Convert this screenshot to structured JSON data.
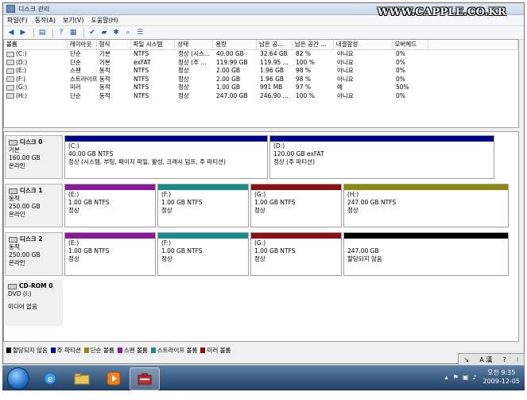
{
  "window": {
    "title": "디스크 관리"
  },
  "watermark": "WWW.CAPPLE.CO.KR",
  "menu": [
    "파일(F)",
    "동작(A)",
    "보기(V)",
    "도움말(H)"
  ],
  "volume_table": {
    "columns": [
      "볼륨",
      "레이아웃",
      "형식",
      "파일 시스템",
      "상태",
      "용량",
      "남은 공...",
      "남은 공간 ...",
      "내결함성",
      "오버헤드"
    ],
    "rows": [
      [
        "(C:)",
        "단순",
        "기본",
        "NTFS",
        "정상 (시스...",
        "40.00 GB",
        "32.64 GB",
        "82 %",
        "아니요",
        "0%"
      ],
      [
        "(D:)",
        "단순",
        "기본",
        "exFAT",
        "정상 (주 ...",
        "119.99 GB",
        "119.95 ...",
        "100 %",
        "아니요",
        "0%"
      ],
      [
        "(E:)",
        "스팬",
        "동적",
        "NTFS",
        "정상",
        "2.00 GB",
        "1.96 GB",
        "98 %",
        "아니요",
        "0%"
      ],
      [
        "(F:)",
        "스트라이프",
        "동적",
        "NTFS",
        "정상",
        "2.00 GB",
        "1.96 GB",
        "98 %",
        "아니요",
        "0%"
      ],
      [
        "(G:)",
        "미러",
        "동적",
        "NTFS",
        "정상",
        "1.00 GB",
        "991 MB",
        "97 %",
        "예",
        "50%"
      ],
      [
        "(H:)",
        "단순",
        "동적",
        "NTFS",
        "정상",
        "247.00 GB",
        "246.90 ...",
        "100 %",
        "아니요",
        "0%"
      ]
    ]
  },
  "disks": [
    {
      "name": "디스크 0",
      "line2": "기본",
      "line3": "160.00 GB",
      "line4": "온라인",
      "parts": [
        {
          "label": "(C:)",
          "line1": "40.00 GB NTFS",
          "line2": "정상 (시스템, 부팅, 페이지 파일, 활성, 크래시 덤프, 주 파티션)",
          "color": "#00008b"
        },
        {
          "label": "(D:)",
          "line1": "120.00 GB exFAT",
          "line2": "정상 (주 파티션)",
          "color": "#00008b"
        }
      ]
    },
    {
      "name": "디스크 1",
      "line2": "동적",
      "line3": "250.00 GB",
      "line4": "온라인",
      "parts": [
        {
          "label": "(E:)",
          "line1": "1.00 GB NTFS",
          "line2": "정상",
          "color": "#8b1a9b"
        },
        {
          "label": "(F:)",
          "line1": "1.00 GB NTFS",
          "line2": "정상",
          "color": "#1a8a8a"
        },
        {
          "label": "(G:)",
          "line1": "1.00 GB NTFS",
          "line2": "정상",
          "color": "#8b1010"
        },
        {
          "label": "(H:)",
          "line1": "247.00 GB NTFS",
          "line2": "정상",
          "color": "#8a8a10"
        }
      ]
    },
    {
      "name": "디스크 2",
      "line2": "동적",
      "line3": "250.00 GB",
      "line4": "온라인",
      "parts": [
        {
          "label": "(E:)",
          "line1": "1.00 GB NTFS",
          "line2": "정상",
          "color": "#8b1a9b"
        },
        {
          "label": "(F:)",
          "line1": "1.00 GB NTFS",
          "line2": "정상",
          "color": "#1a8a8a"
        },
        {
          "label": "(G:)",
          "line1": "1.00 GB NTFS",
          "line2": "정상",
          "color": "#8b1010"
        },
        {
          "label": "",
          "line1": "247.00 GB",
          "line2": "할당되지 않음",
          "color": "#000000"
        }
      ]
    }
  ],
  "cdrom": {
    "name": "CD-ROM 0",
    "line2": "DVD (I:)",
    "line3": "미디어 없음"
  },
  "legend": [
    {
      "label": "할당되지 않음",
      "color": "#000000"
    },
    {
      "label": "주 파티션",
      "color": "#00008b"
    },
    {
      "label": "단순 볼륨",
      "color": "#8a8a10"
    },
    {
      "label": "스팬 볼륨",
      "color": "#8b1a9b"
    },
    {
      "label": "스트라이프 볼륨",
      "color": "#1a8a8a"
    },
    {
      "label": "미러 볼륨",
      "color": "#8b1010"
    }
  ],
  "ime": {
    "text": "A 漢"
  },
  "clock": {
    "time": "오전 9:35",
    "date": "2009-12-05"
  }
}
